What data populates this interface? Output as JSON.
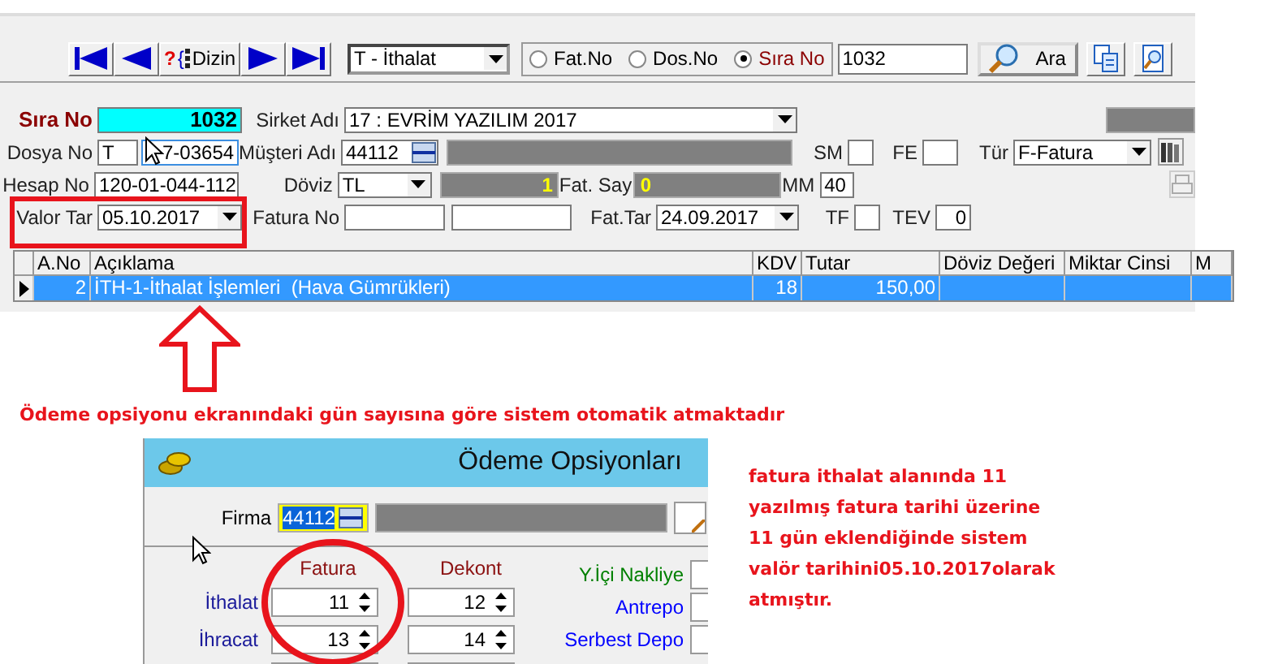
{
  "toolbar": {
    "nav_buttons": [
      {
        "kind": "first"
      },
      {
        "kind": "prev"
      },
      {
        "kind": "index",
        "mark": "?",
        "brace": "{",
        "label": "Dizin"
      },
      {
        "kind": "next"
      },
      {
        "kind": "last"
      }
    ],
    "type_select": "T - İthalat",
    "search_by": [
      {
        "label": "Fat.No",
        "selected": false
      },
      {
        "label": "Dos.No",
        "selected": false
      },
      {
        "label": "Sıra No",
        "selected": true
      }
    ],
    "search_value": "1032",
    "search_button": "Ara"
  },
  "form": {
    "sira_no": {
      "label": "Sıra No",
      "value": "1032"
    },
    "sirket": {
      "label": "Sirket Adı",
      "value": "17 : EVRİM YAZILIM 2017"
    },
    "dosya_no": {
      "label": "Dosya No",
      "prefix": "T",
      "value": "7-03654"
    },
    "musteri": {
      "label": "Müşteri Adı",
      "value": "44112"
    },
    "hesap_no": {
      "label": "Hesap No",
      "value": "120-01-044-112"
    },
    "doviz": {
      "label": "Döviz",
      "value": "TL",
      "rate": "1"
    },
    "fat_say": {
      "label": "Fat. Say",
      "value": "0"
    },
    "valor_tar": {
      "label": "Valor Tar",
      "value": "05.10.2017"
    },
    "fatura_no": {
      "label": "Fatura No"
    },
    "fat_tar": {
      "label": "Fat.Tar",
      "value": "24.09.2017"
    },
    "sm": {
      "label": "SM"
    },
    "fe": {
      "label": "FE"
    },
    "tur": {
      "label": "Tür",
      "value": "F-Fatura"
    },
    "mm": {
      "label": "MM",
      "value": "40"
    },
    "tf": {
      "label": "TF"
    },
    "tev": {
      "label": "TEV",
      "value": "0"
    }
  },
  "table": {
    "columns": [
      "A.No",
      "Açıklama",
      "KDV",
      "Tutar",
      "Döviz Değeri",
      "Miktar Cinsi",
      "M"
    ],
    "rows": [
      {
        "selected": true,
        "a_no": "2",
        "aciklama": "İTH-1-İthalat İşlemleri  (Hava Gümrükleri)",
        "kdv": "18",
        "tutar": "150,00"
      }
    ]
  },
  "note_top": "Ödeme opsiyonu ekranındaki gün sayısına göre sistem otomatik atmaktadır",
  "dialog": {
    "title": "Ödeme Opsiyonları",
    "firma": {
      "label": "Firma",
      "value": "44112"
    },
    "columns": [
      "Fatura",
      "Dekont"
    ],
    "rows": [
      {
        "label": "İthalat",
        "fatura": "11",
        "dekont": "12"
      },
      {
        "label": "İhracat",
        "fatura": "13",
        "dekont": "14"
      }
    ],
    "side_fields": [
      {
        "label": "Y.İçi Nakliye",
        "color": "#008000"
      },
      {
        "label": "Antrepo",
        "color": "#0000ff"
      },
      {
        "label": "Serbest Depo",
        "color": "#0000ff"
      }
    ]
  },
  "note_right": "fatura ithalat alanında 11\nyazılmış fatura tarihi üzerine\n11 gün eklendiğinde sistem\nvalör tarihini05.10.2017olarak\natmıştır."
}
